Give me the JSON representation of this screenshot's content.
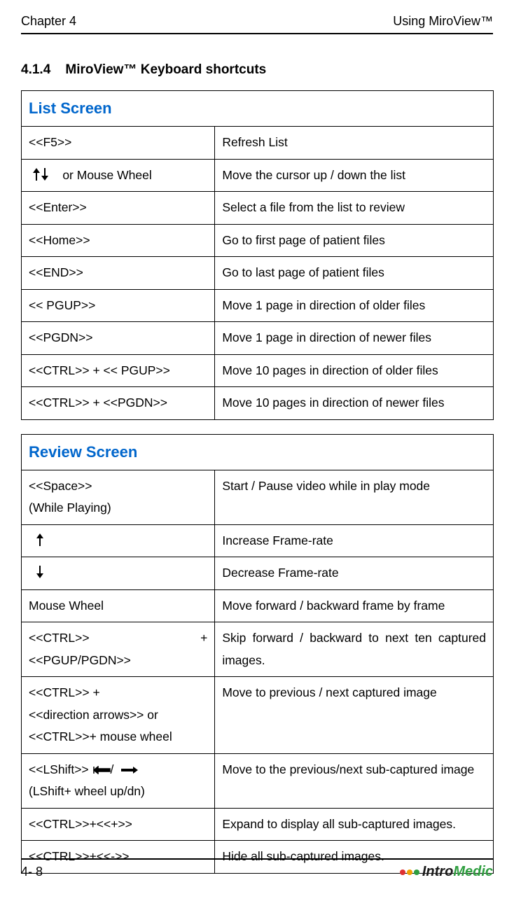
{
  "header": {
    "chapter": "Chapter 4",
    "title": "Using MiroView™"
  },
  "section": {
    "number": "4.1.4",
    "title": "MiroView™ Keyboard shortcuts"
  },
  "tables": {
    "list_screen": {
      "title": "List Screen",
      "rows": [
        {
          "key": "<<F5>>",
          "desc": "Refresh List"
        },
        {
          "key_prefix_icons": true,
          "key": "   or Mouse Wheel",
          "desc": "Move the cursor up / down the list"
        },
        {
          "key": "<<Enter>>",
          "desc": "Select a file from the list to review"
        },
        {
          "key": "<<Home>>",
          "desc": "Go to first page of patient files"
        },
        {
          "key": "<<END>>",
          "desc": " Go to last page of patient files"
        },
        {
          "key": "<< PGUP>>",
          "desc": "Move 1 page in direction of older files"
        },
        {
          "key": "<<PGDN>>",
          "desc": "Move 1 page in direction of newer files"
        },
        {
          "key": "<<CTRL>> + << PGUP>>",
          "desc": "Move 10 pages in direction of older files"
        },
        {
          "key": "<<CTRL>> + <<PGDN>>",
          "desc": "Move 10 pages in direction of newer files"
        }
      ]
    },
    "review_screen": {
      "title": "Review Screen",
      "rows": [
        {
          "key_lines": [
            "<<Space>>",
            "(While Playing)"
          ],
          "desc": "Start / Pause video while in play mode"
        },
        {
          "icon_only": "up",
          "desc": "Increase Frame-rate"
        },
        {
          "icon_only": "down",
          "desc": "Decrease Frame-rate"
        },
        {
          "key": "Mouse Wheel",
          "desc": "Move forward / backward frame by frame"
        },
        {
          "key_ctrl_plus": {
            "left": "<<CTRL>>",
            "right": "+",
            "second": "<<PGUP/PGDN>>"
          },
          "desc": "Skip forward / backward to next ten captured images.",
          "justify": true
        },
        {
          "key_lines": [
            "<<CTRL>> +",
            "<<direction arrows>> or",
            "<<CTRL>>+ mouse wheel"
          ],
          "desc": "Move to previous / next  captured image"
        },
        {
          "key_shift_arrows": {
            "prefix": "<<LShift>> ",
            "suffix": "(LShift+ wheel up/dn)"
          },
          "desc": "Move to the previous/next sub-captured image",
          "justify": true
        },
        {
          "key": "<<CTRL>>+<<+>>",
          "desc": "Expand to display all sub-captured images.",
          "justify": true
        },
        {
          "key": "<<CTRL>>+<<->>",
          "desc": "   Hide all sub-captured images."
        }
      ]
    }
  },
  "footer": {
    "page": "4- 8",
    "logo": {
      "intro": "Intro",
      "medic": "Medic",
      "bullets": [
        "#e03030",
        "#f0a000",
        "#2e9e3f"
      ]
    }
  }
}
